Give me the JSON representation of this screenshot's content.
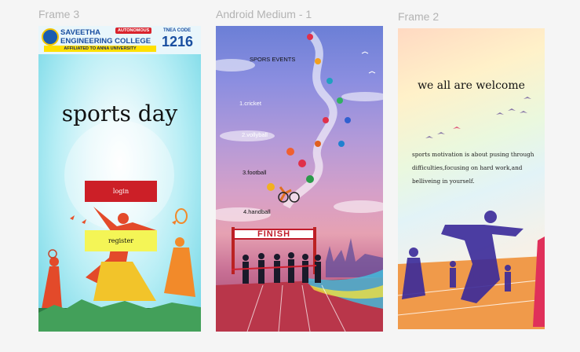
{
  "frames": {
    "frame3": {
      "label": "Frame 3",
      "college": {
        "name_line1": "SAVEETHA",
        "name_line2": "ENGINEERING COLLEGE",
        "badge": "AUTONOMOUS",
        "affiliation": "AFFILIATED TO ANNA UNIVERSITY",
        "tnea_label": "TNEA CODE",
        "tnea_code": "1216"
      },
      "title": "sports day",
      "login_label": "login",
      "register_label": "register"
    },
    "android": {
      "label": "Android Medium - 1",
      "heading": "SPORS EVENTS",
      "events": [
        "1.cricket",
        "2.vollyball",
        "3.football",
        "4.handball"
      ],
      "finish_banner": "FINISH"
    },
    "frame2": {
      "label": "Frame 2",
      "heading": "we all are welcome",
      "paragraph_lines": [
        "sports motivation is about pusing through",
        "difficulties,focusing on hard work,and",
        "belliveing in yourself."
      ]
    }
  },
  "colors": {
    "login_bg": "#cc1f27",
    "register_bg": "#f4f556",
    "finish_red": "#c01c2a"
  }
}
